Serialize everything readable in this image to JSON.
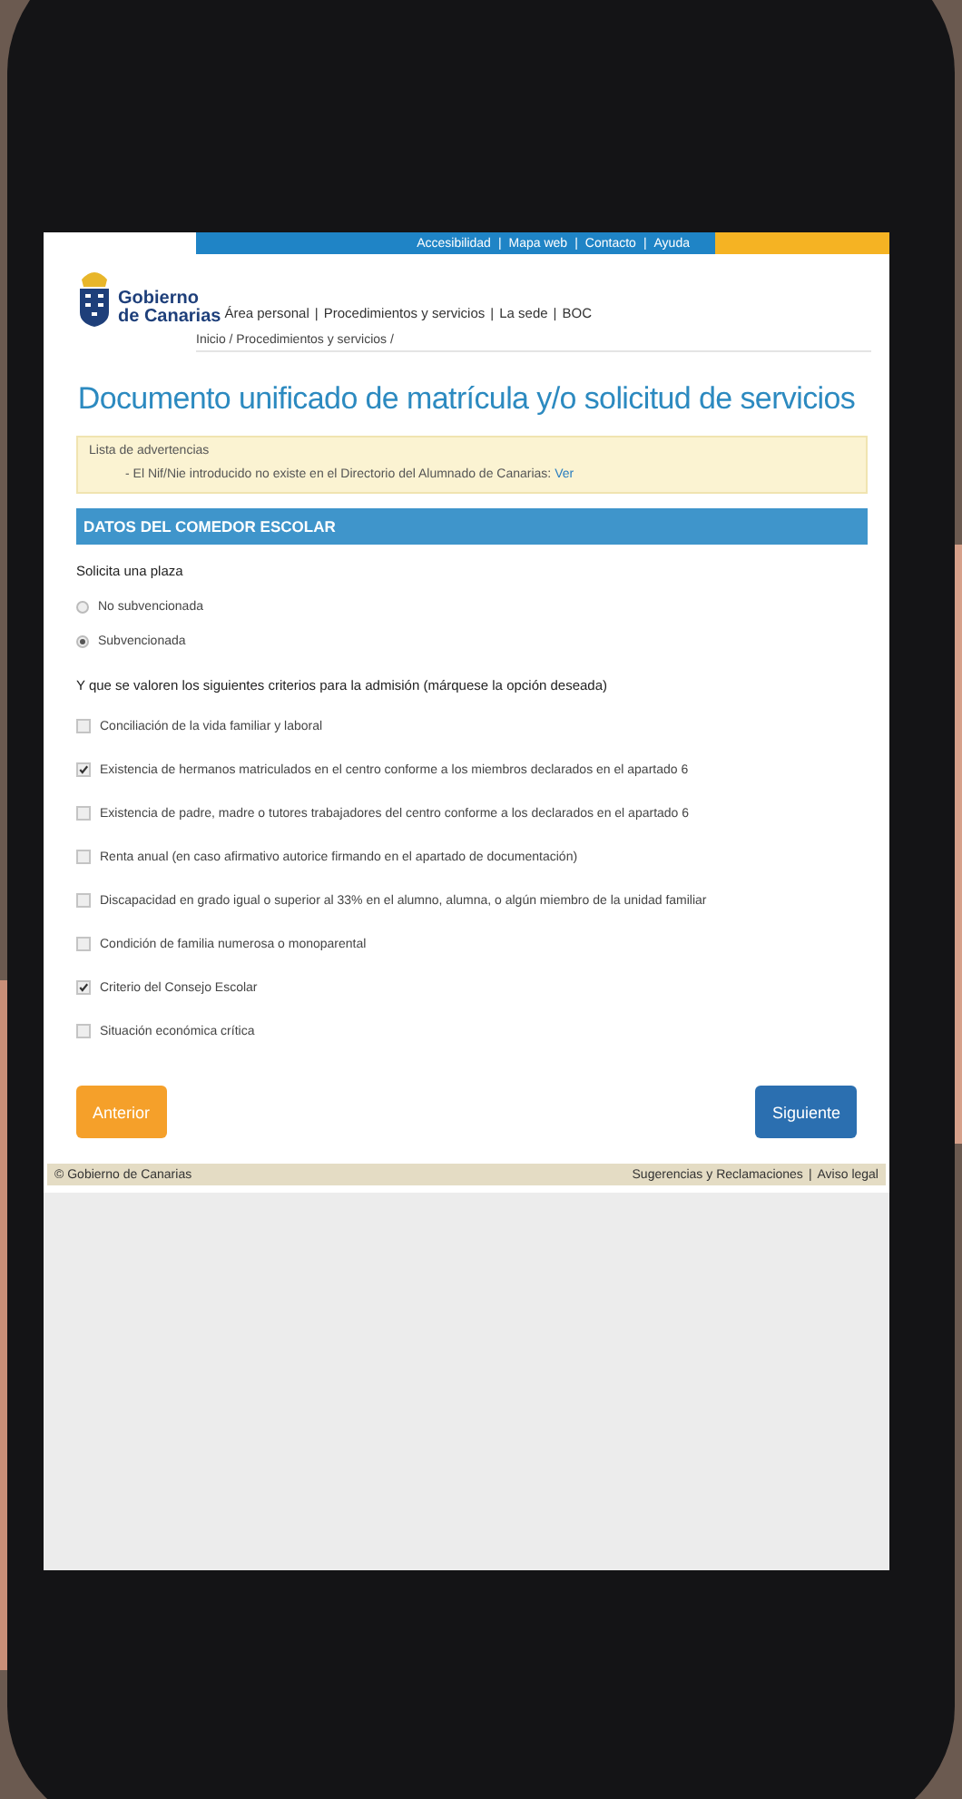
{
  "top_bar": {
    "links": [
      "Accesibilidad",
      "Mapa web",
      "Contacto",
      "Ayuda"
    ],
    "separator": "|"
  },
  "logo": {
    "line_1": "Gobierno",
    "line_2": "de Canarias"
  },
  "nav": {
    "links": [
      "Área personal",
      "Procedimientos y servicios",
      "La sede",
      "BOC"
    ],
    "separator": "|"
  },
  "breadcrumb": "Inicio / Procedimientos y servicios /",
  "page_title": "Documento unificado de matrícula y/o solicitud de servicios",
  "warnings": {
    "title": "Lista de advertencias",
    "message": "- El Nif/Nie introducido no existe en el Directorio del Alumnado de Canarias:",
    "link": "Ver"
  },
  "section": {
    "title": "DATOS DEL COMEDOR ESCOLAR",
    "question_1": "Solicita una plaza",
    "radios": [
      {
        "label": "No subvencionada",
        "selected": false
      },
      {
        "label": "Subvencionada",
        "selected": true
      }
    ],
    "question_2": "Y que se valoren los siguientes criterios para la admisión (márquese la opción deseada)",
    "checkboxes": [
      {
        "label": "Conciliación de la vida familiar y laboral",
        "checked": false
      },
      {
        "label": "Existencia de hermanos matriculados en el centro conforme a los miembros declarados en el apartado 6",
        "checked": true
      },
      {
        "label": "Existencia de padre, madre o tutores trabajadores del centro conforme a los declarados en el apartado 6",
        "checked": false
      },
      {
        "label": "Renta anual (en caso afirmativo autorice firmando en el apartado de documentación)",
        "checked": false
      },
      {
        "label": "Discapacidad en grado igual o superior al 33% en el alumno, alumna, o algún miembro de la unidad familiar",
        "checked": false
      },
      {
        "label": "Condición de familia numerosa o monoparental",
        "checked": false
      },
      {
        "label": "Criterio del Consejo Escolar",
        "checked": true
      },
      {
        "label": "Situación económica crítica",
        "checked": false
      }
    ]
  },
  "buttons": {
    "previous": "Anterior",
    "next": "Siguiente"
  },
  "footer": {
    "copyright": "© Gobierno de Canarias",
    "links": [
      "Sugerencias y Reclamaciones",
      "Aviso legal"
    ],
    "separator": "|"
  }
}
